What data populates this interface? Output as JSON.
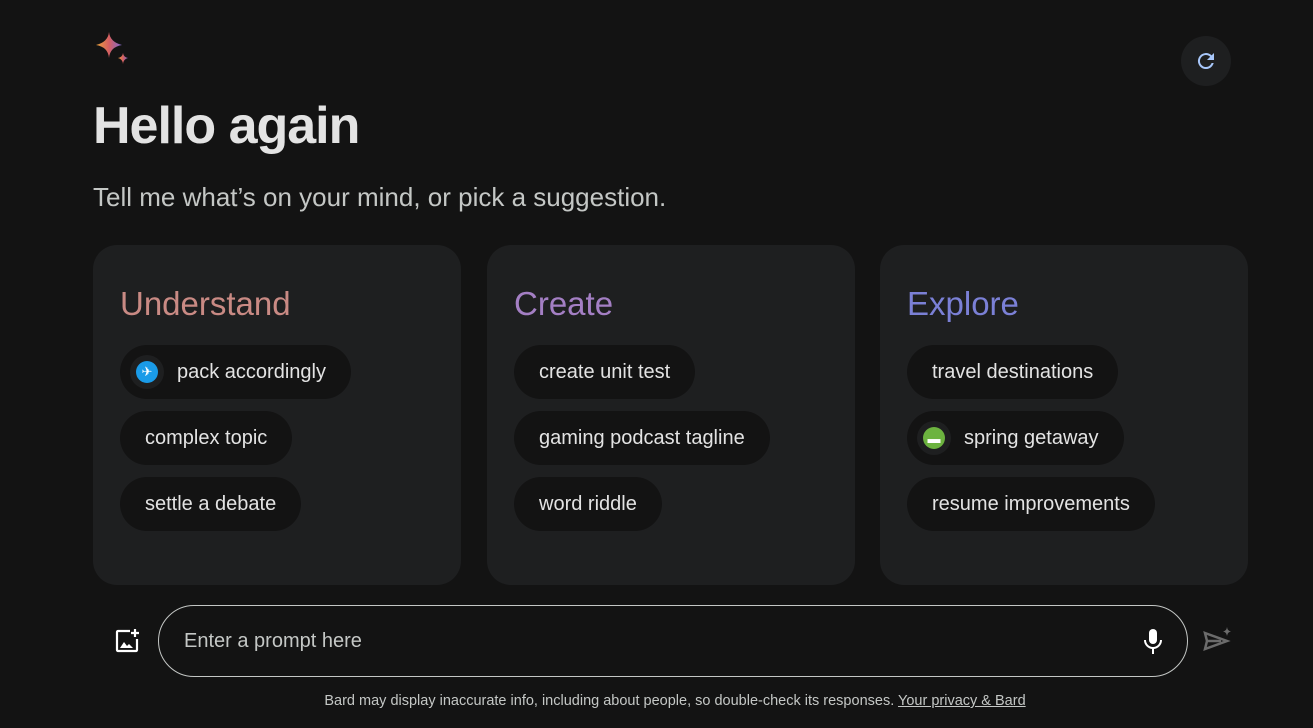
{
  "header": {
    "title": "Hello again",
    "subtitle": "Tell me what’s on your mind, or pick a suggestion."
  },
  "cards": [
    {
      "title": "Understand",
      "color": "#c98a84",
      "chips": [
        {
          "label": "pack accordingly",
          "icon": "airplane-icon",
          "icon_color": "#1a9be8"
        },
        {
          "label": "complex topic"
        },
        {
          "label": "settle a debate"
        }
      ]
    },
    {
      "title": "Create",
      "color": "#a47fc4",
      "chips": [
        {
          "label": "create unit test"
        },
        {
          "label": "gaming podcast tagline"
        },
        {
          "label": "word riddle"
        }
      ]
    },
    {
      "title": "Explore",
      "color": "#7b80d6",
      "chips": [
        {
          "label": "travel destinations"
        },
        {
          "label": "spring getaway",
          "icon": "bed-icon",
          "icon_color": "#6cb33f"
        },
        {
          "label": "resume improvements"
        }
      ]
    }
  ],
  "prompt": {
    "placeholder": "Enter a prompt here"
  },
  "footer": {
    "text": "Bard may display inaccurate info, including about people, so double-check its responses.",
    "link": "Your privacy & Bard"
  }
}
